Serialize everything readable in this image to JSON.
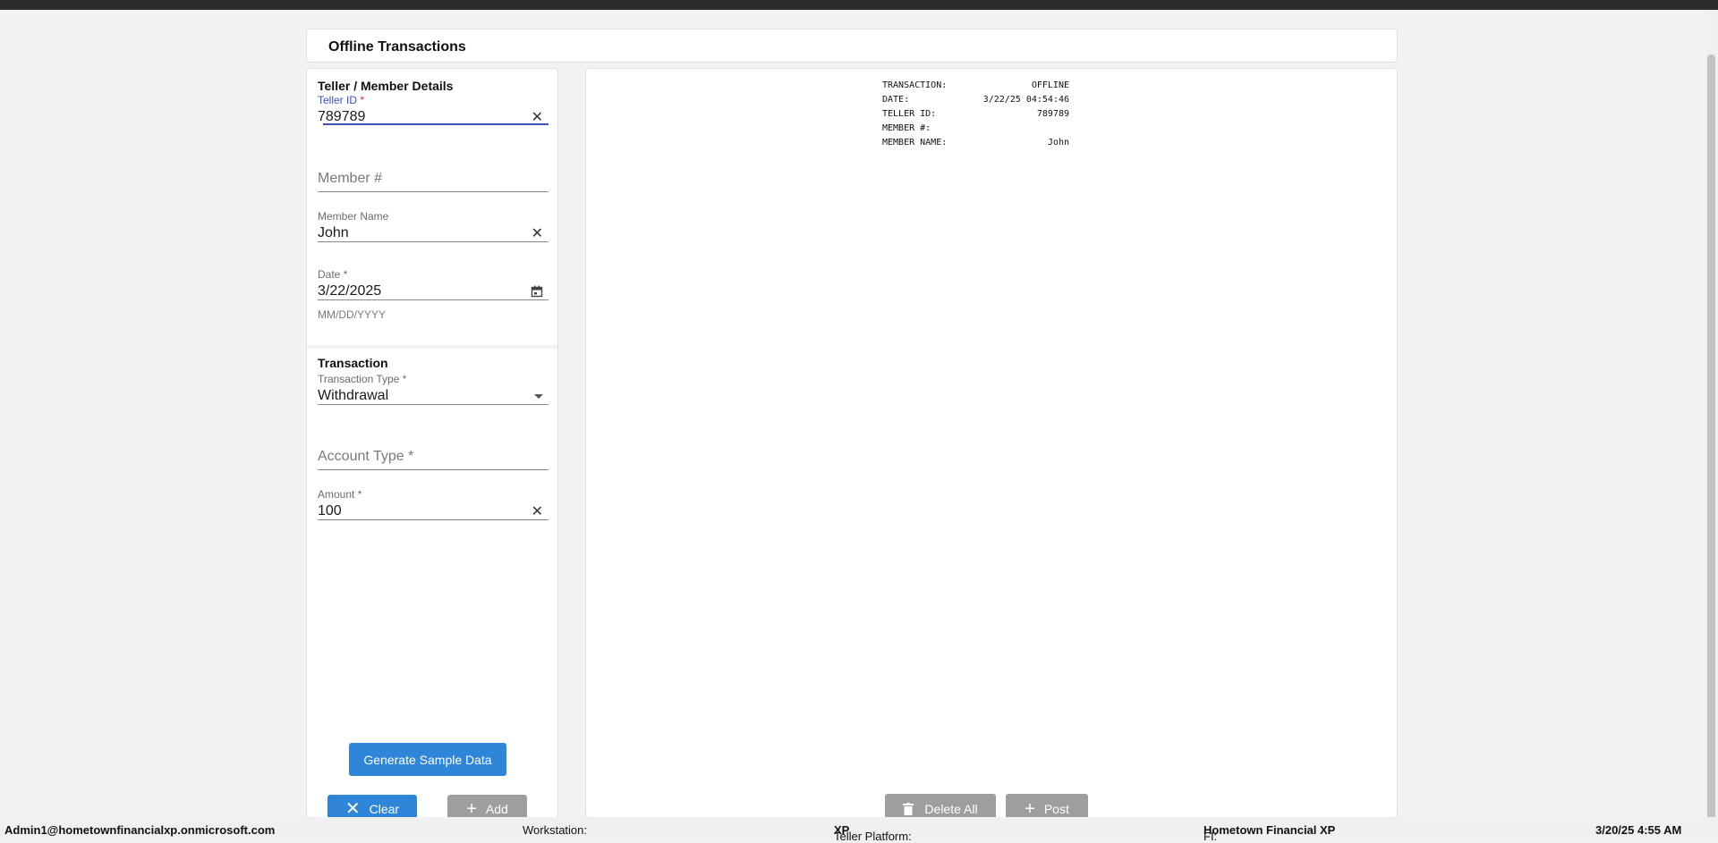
{
  "header": {
    "title": "Offline Transactions"
  },
  "teller_section": {
    "title": "Teller / Member Details",
    "teller_id": {
      "label": "Teller ID",
      "required_mark": " *",
      "value": "789789"
    },
    "member_number": {
      "placeholder": "Member #"
    },
    "member_name": {
      "label": "Member Name",
      "value": "John"
    },
    "date": {
      "label": "Date",
      "required_mark": " *",
      "value": "3/22/2025",
      "helper": "MM/DD/YYYY"
    }
  },
  "transaction_section": {
    "title": "Transaction",
    "transaction_type": {
      "label": "Transaction Type",
      "required_mark": " *",
      "value": "Withdrawal"
    },
    "account_type": {
      "placeholder": "Account Type *"
    },
    "amount": {
      "label": "Amount",
      "required_mark": " *",
      "value": "100"
    }
  },
  "buttons": {
    "generate": "Generate Sample Data",
    "clear": "Clear",
    "add": "Add",
    "delete_all": "Delete All",
    "post": "Post"
  },
  "receipt": {
    "rows": [
      {
        "key": "TRANSACTION:",
        "value": "OFFLINE"
      },
      {
        "key": "DATE:",
        "value": "3/22/25 04:54:46"
      },
      {
        "key": "TELLER ID:",
        "value": "789789"
      },
      {
        "key": "MEMBER #:",
        "value": ""
      },
      {
        "key": "MEMBER NAME:",
        "value": "John"
      }
    ]
  },
  "footer": {
    "user": "Admin1@hometownfinancialxp.onmicrosoft.com",
    "workstation_label": "Workstation:",
    "teller_platform_label": "Teller Platform:",
    "teller_platform_value": "XP",
    "fi_label": "FI:",
    "fi_value": "Hometown Financial XP",
    "datetime": "3/20/25 4:55 AM"
  },
  "colors": {
    "accent": "#2f86d8",
    "focus": "#3f51b5",
    "disabled": "#9e9e9e",
    "error": "#d32f2f"
  }
}
